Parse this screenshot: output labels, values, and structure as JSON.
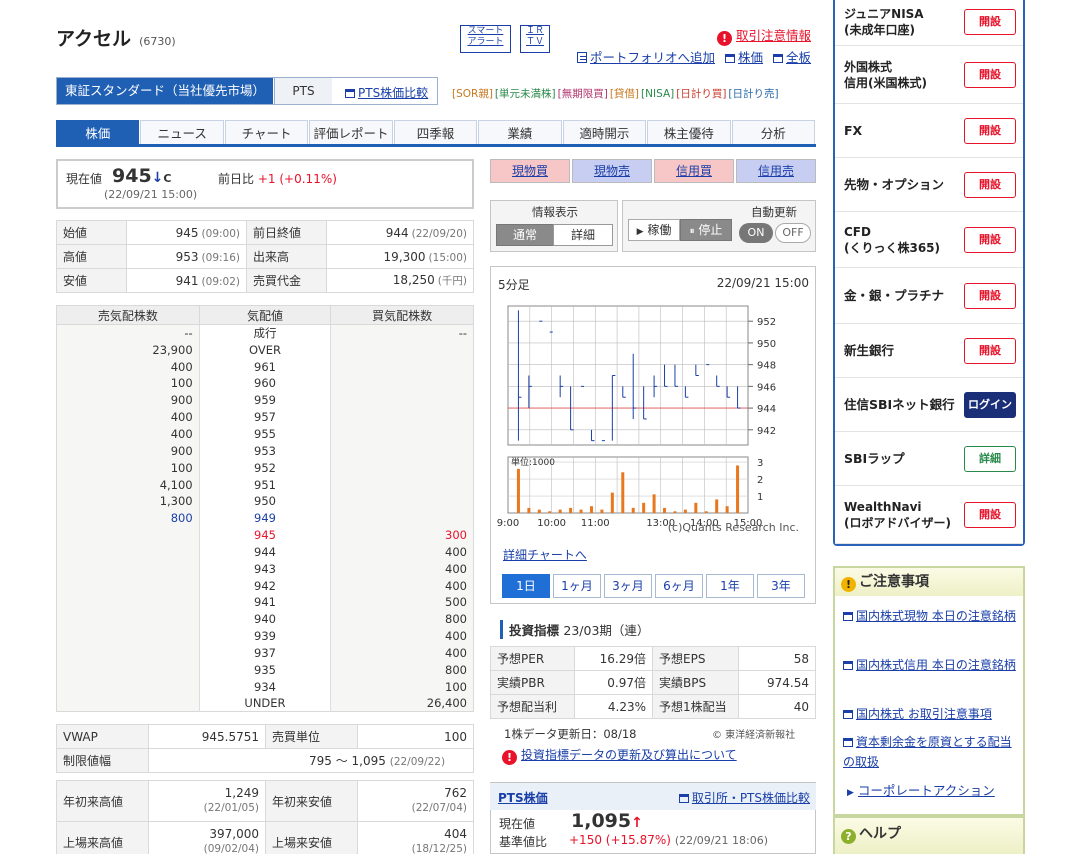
{
  "title": {
    "name": "アクセル",
    "code": "(6730)"
  },
  "header_buttons": {
    "smart_alert": "スマート\nアラート",
    "irtv": "ＩＲ\nＴＶ"
  },
  "header_links": {
    "caution": "取引注意情報",
    "add_portfolio": "ポートフォリオへ追加",
    "stock": "株価",
    "all": "全板"
  },
  "market_tabs": {
    "selected": "東証スタンダード（当社優先市場）",
    "pts": "PTS",
    "pts_compare": "PTS株価比較"
  },
  "badges": [
    {
      "text": "[SOR親]",
      "color": "#c8781e"
    },
    {
      "text": "[単元未満株]",
      "color": "#2a8a4a"
    },
    {
      "text": "[無期限買]",
      "color": "#b0356e"
    },
    {
      "text": "[貸借]",
      "color": "#c8781e"
    },
    {
      "text": "[NISA]",
      "color": "#2a8a4a"
    },
    {
      "text": "[日計り買]",
      "color": "#c83a2a"
    },
    {
      "text": "[日計り売]",
      "color": "#2a6aa8"
    }
  ],
  "nav_tabs": [
    "株価",
    "ニュース",
    "チャート",
    "評価レポート",
    "四季報",
    "業績",
    "適時開示",
    "株主優待",
    "分析"
  ],
  "price": {
    "label": "現在値",
    "value": "945",
    "arrow": "↓",
    "flag": "C",
    "datetime": "(22/09/21 15:00)",
    "change_label": "前日比",
    "change": "+1",
    "change_pct": "(+0.11%)"
  },
  "summary": [
    {
      "l1": "始値",
      "v1": "945",
      "t1": "(09:00)",
      "l2": "前日終値",
      "v2": "944",
      "t2": "(22/09/20)"
    },
    {
      "l1": "高値",
      "v1": "953",
      "t1": "(09:16)",
      "l2": "出来高",
      "v2": "19,300",
      "t2": "(15:00)"
    },
    {
      "l1": "安値",
      "v1": "941",
      "t1": "(09:02)",
      "l2": "売買代金",
      "v2": "18,250",
      "t2": "(千円)"
    }
  ],
  "book": {
    "headers": [
      "売気配株数",
      "気配値",
      "買気配株数"
    ],
    "rows": [
      {
        "s": "--",
        "p": "成行",
        "b": "--"
      },
      {
        "s": "23,900",
        "p": "OVER",
        "b": ""
      },
      {
        "s": "400",
        "p": "961",
        "b": ""
      },
      {
        "s": "100",
        "p": "960",
        "b": ""
      },
      {
        "s": "900",
        "p": "959",
        "b": ""
      },
      {
        "s": "400",
        "p": "957",
        "b": ""
      },
      {
        "s": "400",
        "p": "955",
        "b": ""
      },
      {
        "s": "900",
        "p": "953",
        "b": ""
      },
      {
        "s": "100",
        "p": "952",
        "b": ""
      },
      {
        "s": "4,100",
        "p": "951",
        "b": ""
      },
      {
        "s": "1,300",
        "p": "950",
        "b": ""
      },
      {
        "s": "800",
        "p": "949",
        "b": "",
        "cls": "blue"
      },
      {
        "s": "",
        "p": "945",
        "b": "300",
        "cls": "red"
      },
      {
        "s": "",
        "p": "944",
        "b": "400"
      },
      {
        "s": "",
        "p": "943",
        "b": "400"
      },
      {
        "s": "",
        "p": "942",
        "b": "400"
      },
      {
        "s": "",
        "p": "941",
        "b": "500"
      },
      {
        "s": "",
        "p": "940",
        "b": "800"
      },
      {
        "s": "",
        "p": "939",
        "b": "400"
      },
      {
        "s": "",
        "p": "937",
        "b": "400"
      },
      {
        "s": "",
        "p": "935",
        "b": "800"
      },
      {
        "s": "",
        "p": "934",
        "b": "100"
      },
      {
        "s": "",
        "p": "UNDER",
        "b": "26,400"
      }
    ]
  },
  "extra": {
    "vwap_label": "VWAP",
    "vwap": "945.5751",
    "unit_label": "売買単位",
    "unit": "100",
    "limit_label": "制限値幅",
    "limit": "795 〜 1,095",
    "limit_date": "(22/09/22)"
  },
  "yearly": [
    {
      "l1": "年初来高値",
      "v1": "1,249",
      "d1": "(22/01/05)",
      "l2": "年初来安値",
      "v2": "762",
      "d2": "(22/07/04)"
    },
    {
      "l1": "上場来高値",
      "v1": "397,000",
      "d1": "(09/02/04)",
      "l2": "上場来安値",
      "v2": "404",
      "d2": "(18/12/25)"
    }
  ],
  "trade_buttons": [
    {
      "label": "現物買",
      "bg": "#f7c6c6"
    },
    {
      "label": "現物売",
      "bg": "#c8cdf2"
    },
    {
      "label": "信用買",
      "bg": "#f7c6c6"
    },
    {
      "label": "信用売",
      "bg": "#c8cdf2"
    }
  ],
  "display": {
    "title": "情報表示",
    "normal": "通常",
    "detail": "詳細"
  },
  "operation": {
    "running": "稼働",
    "stopped": "停止"
  },
  "autoupdate": {
    "title": "自動更新",
    "on": "ON",
    "off": "OFF"
  },
  "chart": {
    "period_label": "5分足",
    "datetime": "22/09/21 15:00",
    "volume_unit": "単位:1000",
    "credit": "(c)Quants Research Inc.",
    "detail_link": "詳細チャートへ",
    "periods": [
      "1日",
      "1ヶ月",
      "3ヶ月",
      "6ヶ月",
      "1年",
      "3年"
    ]
  },
  "chart_data": {
    "type": "line",
    "price_ticks": [
      952,
      950,
      948,
      946,
      944,
      942
    ],
    "ylim": [
      940.6,
      953.4
    ],
    "prev_close": 944,
    "volume_ticks": [
      3,
      2,
      1
    ],
    "volume_ylim": [
      0,
      3.3
    ],
    "x_ticks": [
      "9:00",
      "10:00",
      "11:00",
      "13:00",
      "14:00",
      "15:00"
    ],
    "candles": [
      {
        "hi": 953,
        "lo": 941,
        "c": 945
      },
      {
        "hi": 947,
        "lo": 944,
        "c": 946
      },
      {
        "hi": 952,
        "lo": 952,
        "c": 952
      },
      {
        "hi": 951,
        "lo": 951,
        "c": 951
      },
      {
        "hi": 947,
        "lo": 945,
        "c": 946
      },
      {
        "hi": 946,
        "lo": 942,
        "c": 942
      },
      {
        "hi": 946,
        "lo": 946,
        "c": 946
      },
      {
        "hi": 942,
        "lo": 941,
        "c": 941
      },
      {
        "hi": 941,
        "lo": 941,
        "c": 941
      },
      {
        "hi": 947,
        "lo": 941,
        "c": 947
      },
      {
        "hi": 946,
        "lo": 945,
        "c": 945
      },
      {
        "hi": 949,
        "lo": 943,
        "c": 944
      },
      {
        "hi": 946,
        "lo": 943,
        "c": 943
      },
      {
        "hi": 947,
        "lo": 945,
        "c": 946
      },
      {
        "hi": 948,
        "lo": 946,
        "c": 946
      },
      {
        "hi": 948,
        "lo": 946,
        "c": 946
      },
      {
        "hi": 946,
        "lo": 945,
        "c": 945
      },
      {
        "hi": 948,
        "lo": 947,
        "c": 947
      },
      {
        "hi": 948,
        "lo": 948,
        "c": 948
      },
      {
        "hi": 947,
        "lo": 946,
        "c": 946
      },
      {
        "hi": 946,
        "lo": 945,
        "c": 945
      },
      {
        "hi": 946,
        "lo": 944,
        "c": 944
      }
    ],
    "volumes": [
      2.6,
      0.3,
      0.2,
      0.1,
      0.2,
      0.3,
      0.2,
      0.4,
      0.2,
      1.2,
      2.4,
      0.3,
      0.6,
      1.1,
      0.3,
      0.1,
      0.2,
      0.6,
      0.1,
      0.8,
      0.4,
      2.8
    ]
  },
  "indicators": {
    "title": "投資指標",
    "period": "23/03期（連）",
    "rows": [
      {
        "l1": "予想PER",
        "v1": "16.29倍",
        "l2": "予想EPS",
        "v2": "58"
      },
      {
        "l1": "実績PBR",
        "v1": "0.97倍",
        "l2": "実績BPS",
        "v2": "974.54"
      },
      {
        "l1": "予想配当利",
        "v1": "4.23%",
        "l2": "予想1株配当",
        "v2": "40"
      }
    ],
    "update": "1株データ更新日：08/18",
    "source": "© 東洋経済新報社",
    "about_link": "投資指標データの更新及び算出について"
  },
  "pts": {
    "title": "PTS株価",
    "compare_link": "取引所・PTS株価比較",
    "current_label": "現在値",
    "current": "1,095",
    "arrow": "↑",
    "base_label": "基準値比",
    "change": "+150",
    "pct": "(+15.87%)",
    "datetime": "(22/09/21 18:06)"
  },
  "sidebar": {
    "items": [
      {
        "name": "ジュニアNISA\n(未成年口座)",
        "btn": "開設",
        "kind": "open"
      },
      {
        "name": "外国株式\n信用(米国株式)",
        "btn": "開設",
        "kind": "open"
      },
      {
        "name": "FX",
        "btn": "開設",
        "kind": "open"
      },
      {
        "name": "先物・オプション",
        "btn": "開設",
        "kind": "open"
      },
      {
        "name": "CFD\n(くりっく株365)",
        "btn": "開設",
        "kind": "open"
      },
      {
        "name": "金・銀・プラチナ",
        "btn": "開設",
        "kind": "open"
      },
      {
        "name": "新生銀行",
        "btn": "開設",
        "kind": "open"
      },
      {
        "name": "住信SBIネット銀行",
        "btn": "ログイン",
        "kind": "login"
      },
      {
        "name": "SBIラップ",
        "btn": "詳細",
        "kind": "detail"
      },
      {
        "name": "WealthNavi\n(ロボアドバイザー)",
        "btn": "開設",
        "kind": "open"
      }
    ]
  },
  "notice": {
    "title": "ご注意事項",
    "items": [
      "国内株式現物 本日の注意銘柄",
      "国内株式信用 本日の注意銘柄",
      "国内株式 お取引注意事項",
      "資本剰余金を原資とする配当の取扱"
    ],
    "corporate": "コーポレートアクション"
  },
  "help": {
    "title": "ヘルプ"
  },
  "colors": {
    "accent": "#1f5fb4",
    "up": "#e8122a",
    "down": "#1a3fa8"
  }
}
